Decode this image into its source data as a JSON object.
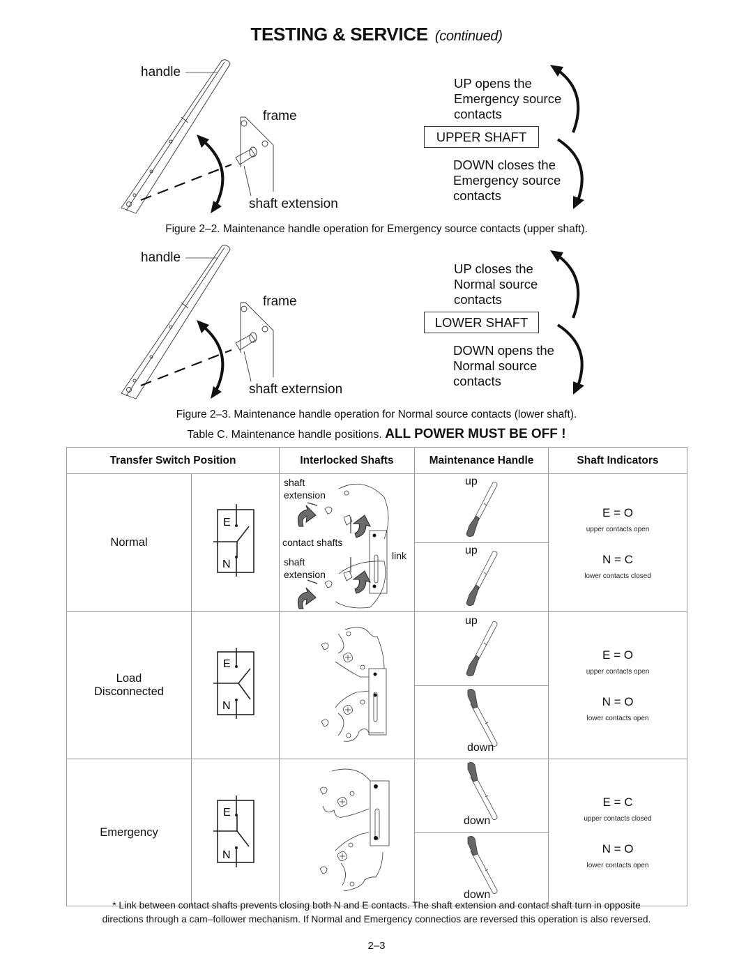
{
  "page": {
    "title": "TESTING & SERVICE",
    "title_suffix": "(continued)",
    "page_number": "2–3"
  },
  "figure_upper": {
    "handle_label": "handle",
    "frame_label": "frame",
    "shaft_label": "shaft extension",
    "up_text": [
      "UP opens the",
      "Emergency source",
      "contacts"
    ],
    "shaft_name": "UPPER SHAFT",
    "down_text": [
      "DOWN closes the",
      "Emergency source",
      "contacts"
    ],
    "caption": "Figure 2–2.  Maintenance handle operation for Emergency source contacts (upper shaft)."
  },
  "figure_lower": {
    "handle_label": "handle",
    "frame_label": "frame",
    "shaft_label": "shaft externsion",
    "up_text": [
      "UP closes the",
      "Normal source",
      "contacts"
    ],
    "shaft_name": "LOWER SHAFT",
    "down_text": [
      "DOWN opens the",
      "Normal source",
      "contacts"
    ],
    "caption": "Figure 2–3.  Maintenance handle operation for Normal source contacts (lower shaft)."
  },
  "table": {
    "caption_prefix": "Table C. Maintenance handle positions.",
    "caption_warning": "ALL POWER MUST BE OFF !",
    "headers": [
      "Transfer Switch Position",
      "Interlocked Shafts",
      "Maintenance Handle",
      "Shaft Indicators"
    ],
    "diagram_labels": {
      "shaft_extension_top": [
        "shaft",
        "extension"
      ],
      "contact_shafts": "contact shafts",
      "shaft_extension_bottom": [
        "shaft",
        "extension"
      ],
      "link": "link",
      "E": "E",
      "N": "N"
    },
    "rows": [
      {
        "position": [
          "Normal"
        ],
        "handles": [
          "up",
          "up"
        ],
        "indicators": [
          {
            "value": "E = O",
            "note": "upper contacts open"
          },
          {
            "value": "N = C",
            "note": "lower contacts closed"
          }
        ]
      },
      {
        "position": [
          "Load",
          "Disconnected"
        ],
        "handles": [
          "up",
          "down"
        ],
        "indicators": [
          {
            "value": "E = O",
            "note": "upper contacts open"
          },
          {
            "value": "N = O",
            "note": "lower contacts open"
          }
        ]
      },
      {
        "position": [
          "Emergency"
        ],
        "handles": [
          "down",
          "down"
        ],
        "indicators": [
          {
            "value": "E = C",
            "note": "upper contacts closed"
          },
          {
            "value": "N = O",
            "note": "lower contacts open"
          }
        ]
      }
    ],
    "footnote": [
      "* Link between contact shafts prevents closing both N and E contacts. The shaft extension and contact shaft turn in opposite",
      "directions through a cam–follower mechanism. If Normal and Emergency connectios are reversed this operation is also reversed."
    ]
  }
}
